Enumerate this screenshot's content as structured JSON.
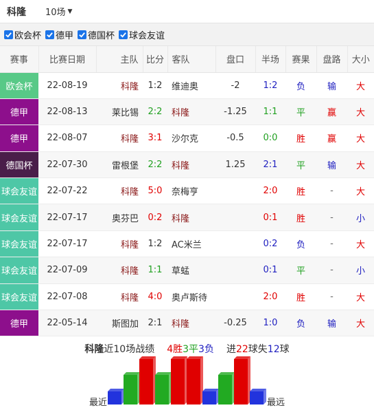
{
  "header": {
    "team": "科隆",
    "match_count": "10场"
  },
  "filters": [
    {
      "label": "欧会杯",
      "checked": true
    },
    {
      "label": "德甲",
      "checked": true
    },
    {
      "label": "德国杯",
      "checked": true
    },
    {
      "label": "球会友谊",
      "checked": true
    }
  ],
  "columns": [
    "赛事",
    "比赛日期",
    "主队",
    "比分",
    "客队",
    "盘口",
    "半场",
    "赛果",
    "盘路",
    "大小"
  ],
  "colors": {
    "欧会杯": "#58c987",
    "德甲": "#8d0f8c",
    "德国杯": "#4a1e4a",
    "球会友谊": "#4ec7a6",
    "bar_win": "#e00000",
    "bar_draw": "#22aa22",
    "bar_loss": "#2233dd"
  },
  "rows": [
    {
      "comp": "欧会杯",
      "date": "22-08-19",
      "home": "科隆",
      "home_hi": true,
      "score": "1:2",
      "away": "维迪奥",
      "away_hi": false,
      "handicap": "-2",
      "half": "1:2",
      "result": "负",
      "cover": "输",
      "ou": "大"
    },
    {
      "comp": "德甲",
      "date": "22-08-13",
      "home": "莱比锡",
      "home_hi": false,
      "score": "2:2",
      "away": "科隆",
      "away_hi": true,
      "handicap": "-1.25",
      "half": "1:1",
      "result": "平",
      "cover": "赢",
      "ou": "大"
    },
    {
      "comp": "德甲",
      "date": "22-08-07",
      "home": "科隆",
      "home_hi": true,
      "score": "3:1",
      "away": "沙尔克",
      "away_hi": false,
      "handicap": "-0.5",
      "half": "0:0",
      "result": "胜",
      "cover": "赢",
      "ou": "大"
    },
    {
      "comp": "德国杯",
      "date": "22-07-30",
      "home": "雷根堡",
      "home_hi": false,
      "score": "2:2",
      "away": "科隆",
      "away_hi": true,
      "handicap": "1.25",
      "half": "2:1",
      "result": "平",
      "cover": "输",
      "ou": "大"
    },
    {
      "comp": "球会友谊",
      "date": "22-07-22",
      "home": "科隆",
      "home_hi": true,
      "score": "5:0",
      "away": "奈梅亨",
      "away_hi": false,
      "handicap": "",
      "half": "2:0",
      "result": "胜",
      "cover": "-",
      "ou": "大"
    },
    {
      "comp": "球会友谊",
      "date": "22-07-17",
      "home": "奥芬巴",
      "home_hi": false,
      "score": "0:2",
      "away": "科隆",
      "away_hi": true,
      "handicap": "",
      "half": "0:1",
      "result": "胜",
      "cover": "-",
      "ou": "小"
    },
    {
      "comp": "球会友谊",
      "date": "22-07-17",
      "home": "科隆",
      "home_hi": true,
      "score": "1:2",
      "away": "AC米兰",
      "away_hi": false,
      "handicap": "",
      "half": "0:2",
      "result": "负",
      "cover": "-",
      "ou": "大"
    },
    {
      "comp": "球会友谊",
      "date": "22-07-09",
      "home": "科隆",
      "home_hi": true,
      "score": "1:1",
      "away": "草蜢",
      "away_hi": false,
      "handicap": "",
      "half": "0:1",
      "result": "平",
      "cover": "-",
      "ou": "小"
    },
    {
      "comp": "球会友谊",
      "date": "22-07-08",
      "home": "科隆",
      "home_hi": true,
      "score": "4:0",
      "away": "奥卢斯待",
      "away_hi": false,
      "handicap": "",
      "half": "2:0",
      "result": "胜",
      "cover": "-",
      "ou": "大"
    },
    {
      "comp": "德甲",
      "date": "22-05-14",
      "home": "斯图加",
      "home_hi": false,
      "score": "2:1",
      "away": "科隆",
      "away_hi": true,
      "handicap": "-0.25",
      "half": "1:0",
      "result": "负",
      "cover": "输",
      "ou": "大"
    }
  ],
  "summary": {
    "team": "科隆",
    "text1": "近10场战绩",
    "wins": "4胜",
    "draws": "3平",
    "losses": "3负",
    "goals_for_label": "进",
    "goals_for": "22",
    "goals_for_unit": "球",
    "goals_against_label": "失",
    "goals_against": "12",
    "goals_against_unit": "球"
  },
  "form_chart": {
    "left_label": "最近",
    "right_label": "最远",
    "results": [
      "负",
      "平",
      "胜",
      "平",
      "胜",
      "胜",
      "负",
      "平",
      "胜",
      "负"
    ]
  }
}
